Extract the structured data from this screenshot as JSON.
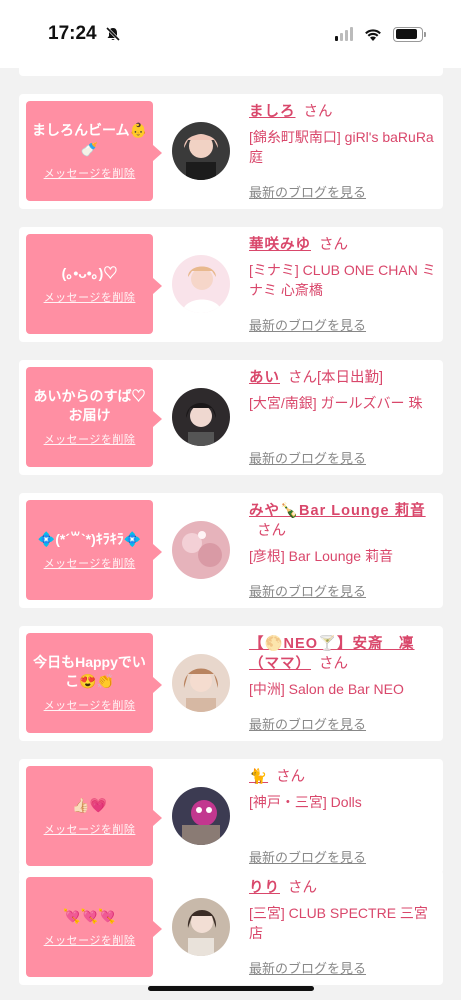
{
  "status_bar": {
    "time": "17:24"
  },
  "common": {
    "delete_label": "メッセージを削除",
    "blog_label": "最新のブログを見る",
    "san": "さん"
  },
  "messages": [
    {
      "message": "ましろんビーム👶🍼",
      "name": "ましろ",
      "status": "",
      "shop": "[錦糸町駅南口] giRl's baRuRa庭",
      "avatar_color": "#3a3a3a"
    },
    {
      "message": "(｡•ᴗ•｡)♡",
      "name": "華咲みゆ",
      "status": "",
      "shop": "[ミナミ] CLUB ONE CHAN ミナミ 心斎橋",
      "avatar_color": "#f6cbd6"
    },
    {
      "message": "あいからのすば♡お届け",
      "name": "あい",
      "status": "[本日出勤]",
      "shop": "[大宮/南銀] ガールズバー 珠",
      "avatar_color": "#2e2a2c"
    },
    {
      "message": "💠(*´꒳`*)ｷﾗｷﾗ💠",
      "name": "みや🍾Bar Lounge 莉音",
      "status": "",
      "shop": "[彦根] Bar Lounge 莉音",
      "avatar_color": "#e6b3bb"
    },
    {
      "message": "今日もHappyでいこ😍👏",
      "name": "【🌕NEO🍸】安斎　凜（ママ）",
      "status": "",
      "shop": "[中洲] Salon de Bar NEO",
      "avatar_color": "#c98a6a"
    },
    {
      "message": "👍🏻💗",
      "name": "🐈",
      "status": "",
      "shop": "[神戸・三宮] Dolls",
      "avatar_color": "#c2378f"
    },
    {
      "message": "💘💘💘",
      "name": "りり",
      "status": "",
      "shop": "[三宮] CLUB SPECTRE 三宮店",
      "avatar_color": "#c8b9aa"
    }
  ]
}
